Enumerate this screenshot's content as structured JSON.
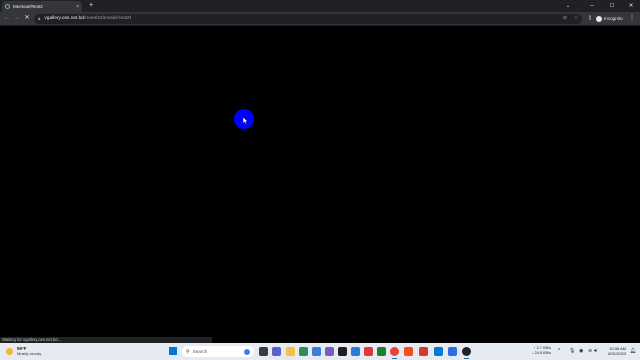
{
  "browser": {
    "tab": {
      "title": "Meetout/#test2",
      "close_glyph": "×"
    },
    "new_tab_glyph": "+",
    "window_controls": {
      "tab_search": "⌄",
      "minimize": "─",
      "maximize": "☐",
      "close": "✕"
    },
    "toolbar": {
      "back": "←",
      "forward": "→",
      "reload": "✕",
      "url_host": "vgallery.oss.net.bd",
      "url_path": "/meet/22/invalid-test2f",
      "incognito_label": "Incognito",
      "menu": "⋮"
    },
    "status_text": "Waiting for vgallery.oss.net.bd..."
  },
  "taskbar": {
    "weather": {
      "temp": "59°F",
      "condition": "Mostly cloudy"
    },
    "search_placeholder": "Search",
    "network": {
      "up": "↑ 2.7 KB/s",
      "down": "↓ 24.8 KB/s"
    },
    "clock": {
      "time": "10:36 AM",
      "date": "8/31/2023"
    },
    "tray_chevron": "^"
  },
  "colors": {
    "cursor_highlight": "#0000ff",
    "page_background": "#000000",
    "browser_frame": "#202124",
    "taskbar": "#e6ebf1"
  },
  "icons": [
    "tab-favicon-icon",
    "close-tab-icon",
    "back-icon",
    "forward-icon",
    "stop-icon",
    "lock-icon",
    "camera-blocked-icon",
    "bookmark-star-icon",
    "side-panel-icon",
    "incognito-icon",
    "menu-icon",
    "weather-icon",
    "windows-start-icon",
    "search-icon"
  ]
}
